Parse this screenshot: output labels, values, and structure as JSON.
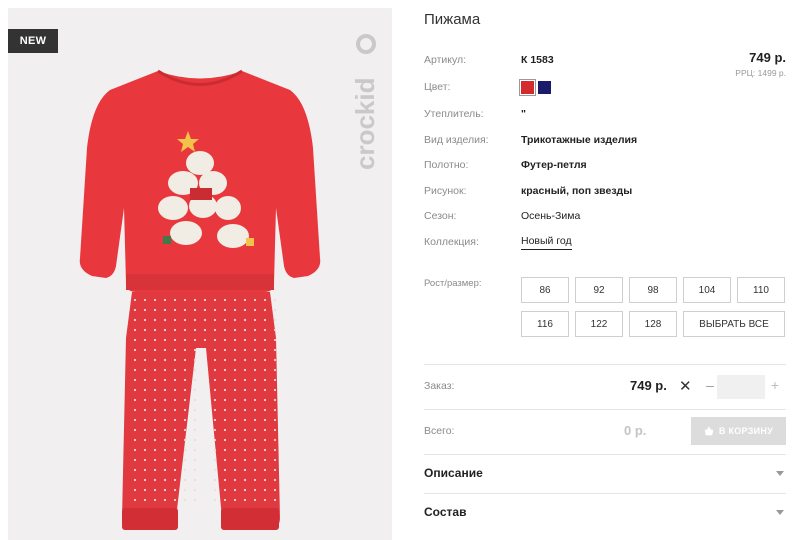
{
  "badge": {
    "label": "NEW"
  },
  "brand": {
    "logo_text": "crockid"
  },
  "product": {
    "title": "Пижама",
    "price": "749 р.",
    "rrp": "РРЦ: 1499 р."
  },
  "attributes": [
    {
      "label": "Артикул:",
      "value": "К 1583"
    },
    {
      "label": "Цвет:"
    },
    {
      "label": "Утеплитель:",
      "value": "\""
    },
    {
      "label": "Вид изделия:",
      "value": "Трикотажные изделия"
    },
    {
      "label": "Полотно:",
      "value": "Футер-петля"
    },
    {
      "label": "Рисунок:",
      "value": "красный, поп звезды"
    },
    {
      "label": "Сезон:",
      "value": "Осень-Зима"
    },
    {
      "label": "Коллекция:",
      "value": "Новый год"
    }
  ],
  "colors": [
    {
      "name": "red",
      "hex": "#d42a2e",
      "selected": true
    },
    {
      "name": "navy",
      "hex": "#1b1a6b",
      "selected": false
    }
  ],
  "sizes": {
    "label": "Рост/размер:",
    "options": [
      "86",
      "92",
      "98",
      "104",
      "110",
      "116",
      "122",
      "128"
    ],
    "select_all": "ВЫБРАТЬ ВСЕ"
  },
  "order": {
    "label": "Заказ:",
    "price": "749 р.",
    "times": "✕",
    "minus": "–",
    "plus": "+",
    "quantity": ""
  },
  "total": {
    "label": "Всего:",
    "value": "0 р.",
    "cart_button": "В КОРЗИНУ"
  },
  "accordions": [
    {
      "title": "Описание"
    },
    {
      "title": "Состав"
    }
  ],
  "palette": {
    "shirt": "#e8383d",
    "pants": "#e03a40",
    "badge_bg": "#333333",
    "logo": "#c9c9c9"
  }
}
